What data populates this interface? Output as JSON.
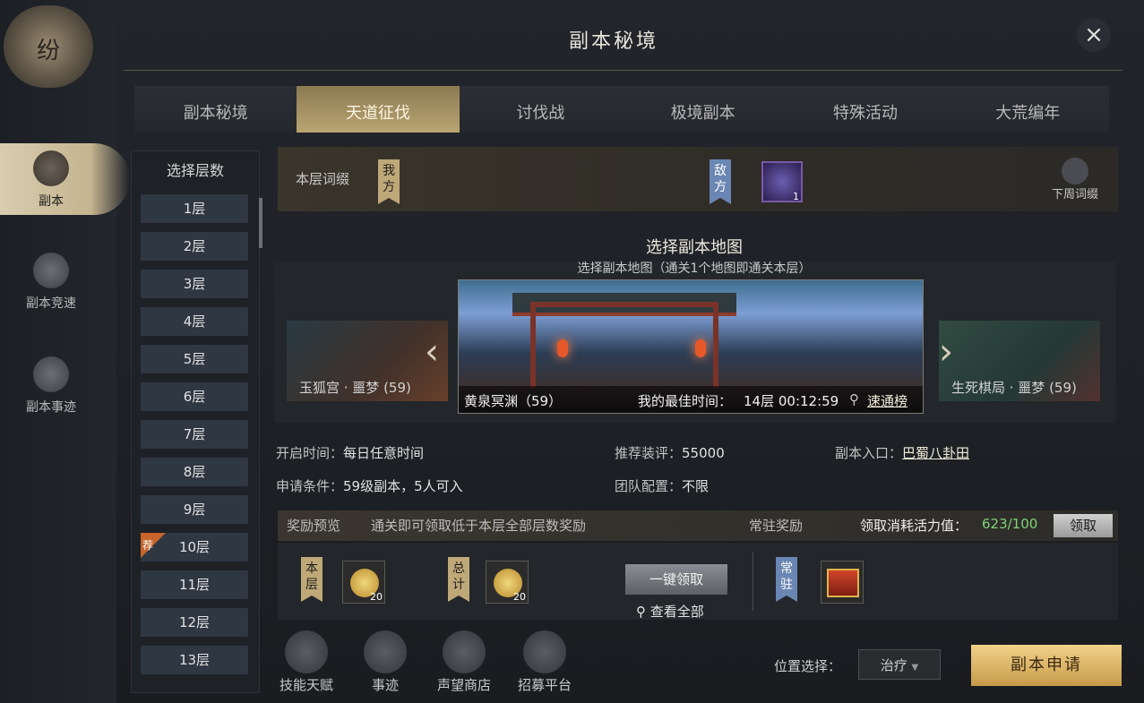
{
  "header": {
    "title": "副本秘境",
    "close_icon": "close-icon"
  },
  "leftnav": {
    "logo_text": "纷",
    "items": [
      {
        "label": "副本",
        "icon": "dungeon-icon",
        "active": true
      },
      {
        "label": "副本竞速",
        "icon": "dungeon-race-icon"
      },
      {
        "label": "副本事迹",
        "icon": "dungeon-deeds-icon"
      }
    ]
  },
  "tabs": [
    "副本秘境",
    "天道征伐",
    "讨伐战",
    "极境副本",
    "特殊活动",
    "大荒编年"
  ],
  "active_tab": 1,
  "floors": {
    "header": "选择层数",
    "items": [
      "1层",
      "2层",
      "3层",
      "4层",
      "5层",
      "6层",
      "7层",
      "8层",
      "9层",
      "10层",
      "11层",
      "12层",
      "13层"
    ],
    "recommended_badge": "荐",
    "recommended_index": 9
  },
  "affix": {
    "label": "本层词缀",
    "ours": "我方",
    "enemy": "敌方",
    "enemy_skill_count": "1",
    "next_week_label": "下周词缀"
  },
  "map": {
    "title": "选择副本地图",
    "subtitle": "选择副本地图（通关1个地图即通关本层）",
    "left": "玉狐宫 · 噩梦 (59)",
    "center": "黄泉冥渊（59）",
    "right": "生死棋局 · 噩梦 (59)",
    "best_time_label": "我的最佳时间：",
    "best_time": "14层  00:12:59",
    "rank_link": "速通榜"
  },
  "info": {
    "open_time_k": "开启时间：",
    "open_time_v": "每日任意时间",
    "gear_k": "推荐装评：",
    "gear_v": "55000",
    "entrance_k": "副本入口：",
    "entrance_v": "巴蜀八卦田",
    "req_k": "申请条件：",
    "req_v": "59级副本，5人可入",
    "team_k": "团队配置：",
    "team_v": "不限"
  },
  "rewards": {
    "preview_label": "奖励预览",
    "preview_desc": "通关即可领取低于本层全部层数奖励",
    "resident_label": "常驻奖励",
    "vitality_label": "领取消耗活力值：",
    "vitality_value": "623/100",
    "claim": "领取",
    "floor_tag": "本层",
    "total_tag": "总计",
    "resident_tag": "常驻",
    "floor_count": "20",
    "total_count": "20",
    "one_click": "一键领取",
    "view_all": "查看全部"
  },
  "bottom": {
    "funcs": [
      "技能天赋",
      "事迹",
      "声望商店",
      "招募平台"
    ],
    "position_label": "位置选择：",
    "position_value": "治疗",
    "apply": "副本申请"
  }
}
